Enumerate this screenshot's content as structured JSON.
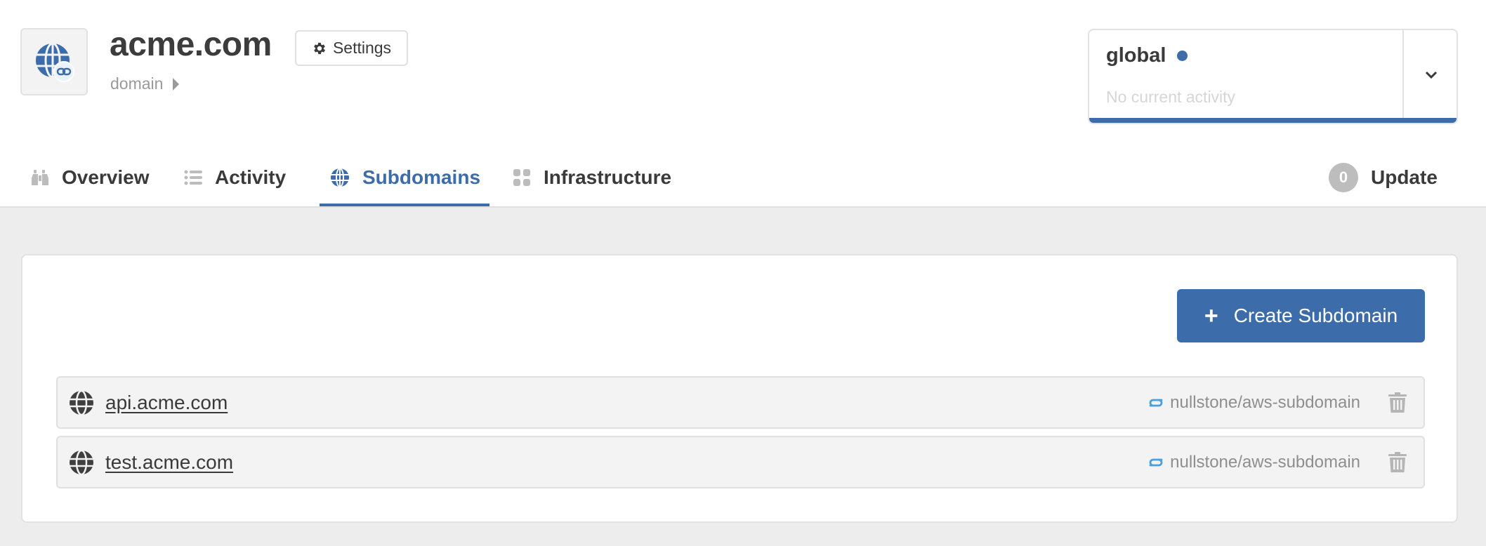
{
  "header": {
    "app_icon": "globe-link-icon",
    "title": "acme.com",
    "subtitle": "domain",
    "settings_label": "Settings",
    "settings_icon": "gear-icon"
  },
  "environment": {
    "name": "global",
    "status_dot_color": "#3d6caa",
    "activity": "No current activity",
    "toggle_icon": "chevron-down-icon"
  },
  "tabs": [
    {
      "label": "Overview",
      "icon": "binoculars-icon",
      "active": false
    },
    {
      "label": "Activity",
      "icon": "list-icon",
      "active": false
    },
    {
      "label": "Subdomains",
      "icon": "globe-icon",
      "active": true
    },
    {
      "label": "Infrastructure",
      "icon": "grid-icon",
      "active": false
    }
  ],
  "update": {
    "count": "0",
    "label": "Update"
  },
  "main": {
    "create_label": "Create Subdomain",
    "create_icon": "plus-icon",
    "subdomains": [
      {
        "name": "api.acme.com",
        "module": "nullstone/aws-subdomain"
      },
      {
        "name": "test.acme.com",
        "module": "nullstone/aws-subdomain"
      }
    ]
  },
  "colors": {
    "primary": "#3d6caa",
    "text": "#3a3a3a",
    "muted": "#9a9a9a",
    "module_icon": "#4a9fe0",
    "background": "#ededed"
  }
}
